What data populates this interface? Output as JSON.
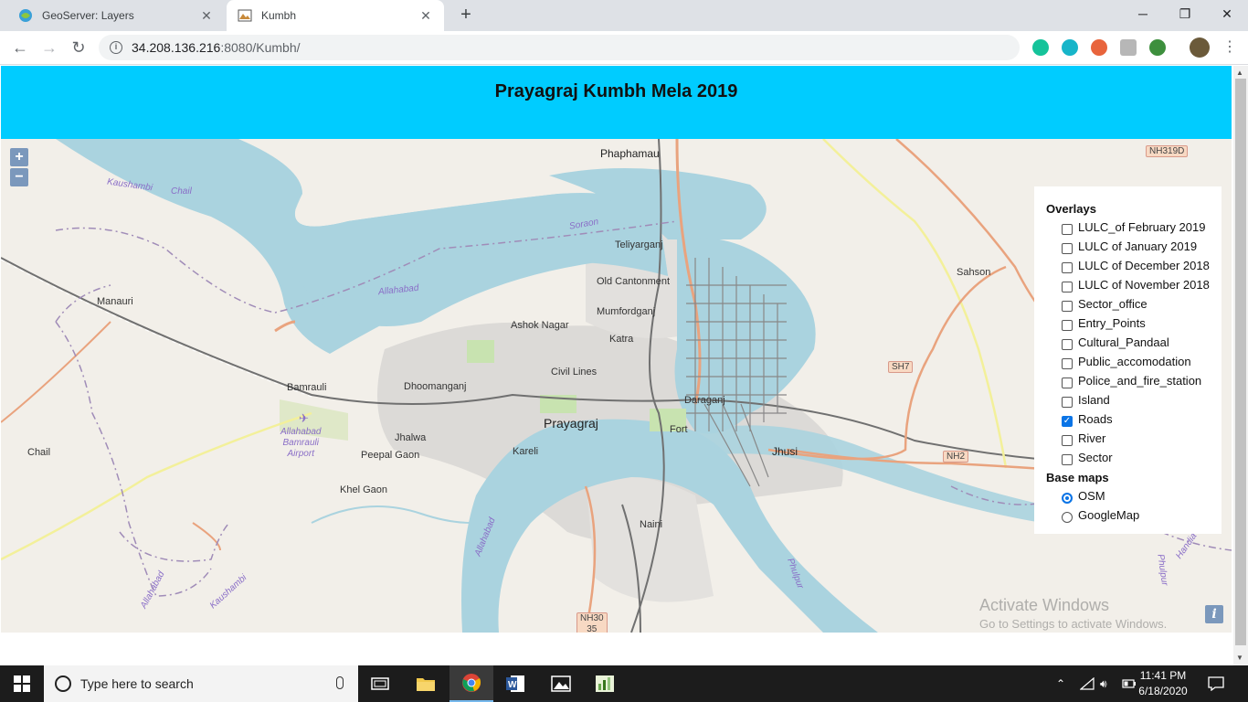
{
  "browser": {
    "tabs": [
      {
        "title": "GeoServer: Layers",
        "active": false
      },
      {
        "title": "Kumbh",
        "active": true
      }
    ],
    "new_tab_symbol": "+",
    "url_host": "34.208.136.216",
    "url_rest": ":8080/Kumbh/",
    "window_controls": {
      "minimize": "─",
      "restore": "❐",
      "close": "✕"
    },
    "nav": {
      "back": "←",
      "forward": "→",
      "reload": "↻"
    },
    "menu_symbol": "⋮"
  },
  "page": {
    "title": "Prayagraj Kumbh Mela 2019",
    "accent_color": "#00ccff"
  },
  "map": {
    "zoom_in": "+",
    "zoom_out": "−",
    "attribution_button": "i",
    "labels": {
      "phaphamau": "Phaphamau",
      "kaushambi_top": "Kaushambi",
      "chail_top": "Chail",
      "soraon": "Soraon",
      "teliyarganj": "Teliyarganj",
      "old_cantonment": "Old Cantonment",
      "mumfordganj": "Mumfordganj",
      "manauri": "Manauri",
      "allahabad_river": "Allahabad",
      "ashok_nagar": "Ashok Nagar",
      "katra": "Katra",
      "civil_lines": "Civil Lines",
      "bamrauli": "Bamrauli",
      "dhoomanganj": "Dhoomanganj",
      "daraganj": "Daraganj",
      "prayagraj": "Prayagraj",
      "fort": "Fort",
      "jhusi": "Jhusi",
      "airport": "Allahabad Bamrauli Airport",
      "airport_l1": "Allahabad",
      "airport_l2": "Bamrauli",
      "airport_l3": "Airport",
      "jhalwa": "Jhalwa",
      "chail_left": "Chail",
      "peepal_gaon": "Peepal Gaon",
      "kareli": "Kareli",
      "khel_gaon": "Khel Gaon",
      "naini": "Naini",
      "sahson": "Sahson",
      "nh319d": "NH319D",
      "sh7": "SH7",
      "nh2": "NH2",
      "nh30": "NH30",
      "nh35": "35",
      "allahabad_bottom": "Allahabad",
      "allahabad_lower_left": "Allahabad",
      "kaushambi_bottom": "Kaushambi",
      "phulpur_1": "Phulpur",
      "phulpur_2": "Phulpur",
      "handia": "Handia"
    },
    "colors": {
      "land": "#f2efe9",
      "water": "#aad3df",
      "river": "#a3cfdc",
      "urban": "#e0dfdf",
      "primary_road": "#e9a37e",
      "secondary_road": "#f7fabf",
      "rail": "#707070",
      "boundary": "#a08cb8"
    }
  },
  "layer_switcher": {
    "overlays_title": "Overlays",
    "overlays": [
      {
        "label": "LULC_of February 2019",
        "checked": false
      },
      {
        "label": "LULC of January 2019",
        "checked": false
      },
      {
        "label": "LULC of December 2018",
        "checked": false
      },
      {
        "label": "LULC of November 2018",
        "checked": false
      },
      {
        "label": "Sector_office",
        "checked": false
      },
      {
        "label": "Entry_Points",
        "checked": false
      },
      {
        "label": "Cultural_Pandaal",
        "checked": false
      },
      {
        "label": "Public_accomodation",
        "checked": false
      },
      {
        "label": "Police_and_fire_station",
        "checked": false
      },
      {
        "label": "Island",
        "checked": false
      },
      {
        "label": "Roads",
        "checked": true
      },
      {
        "label": "River",
        "checked": false
      },
      {
        "label": "Sector",
        "checked": false
      }
    ],
    "basemaps_title": "Base maps",
    "basemaps": [
      {
        "label": "OSM",
        "selected": true
      },
      {
        "label": "GoogleMap",
        "selected": false
      }
    ]
  },
  "watermark": {
    "line1": "Activate Windows",
    "line2": "Go to Settings to activate Windows."
  },
  "taskbar": {
    "search_placeholder": "Type here to search",
    "time": "11:41 PM",
    "date": "6/18/2020",
    "apps": [
      "task-view",
      "file-explorer",
      "chrome",
      "word",
      "photos",
      "excel"
    ]
  }
}
